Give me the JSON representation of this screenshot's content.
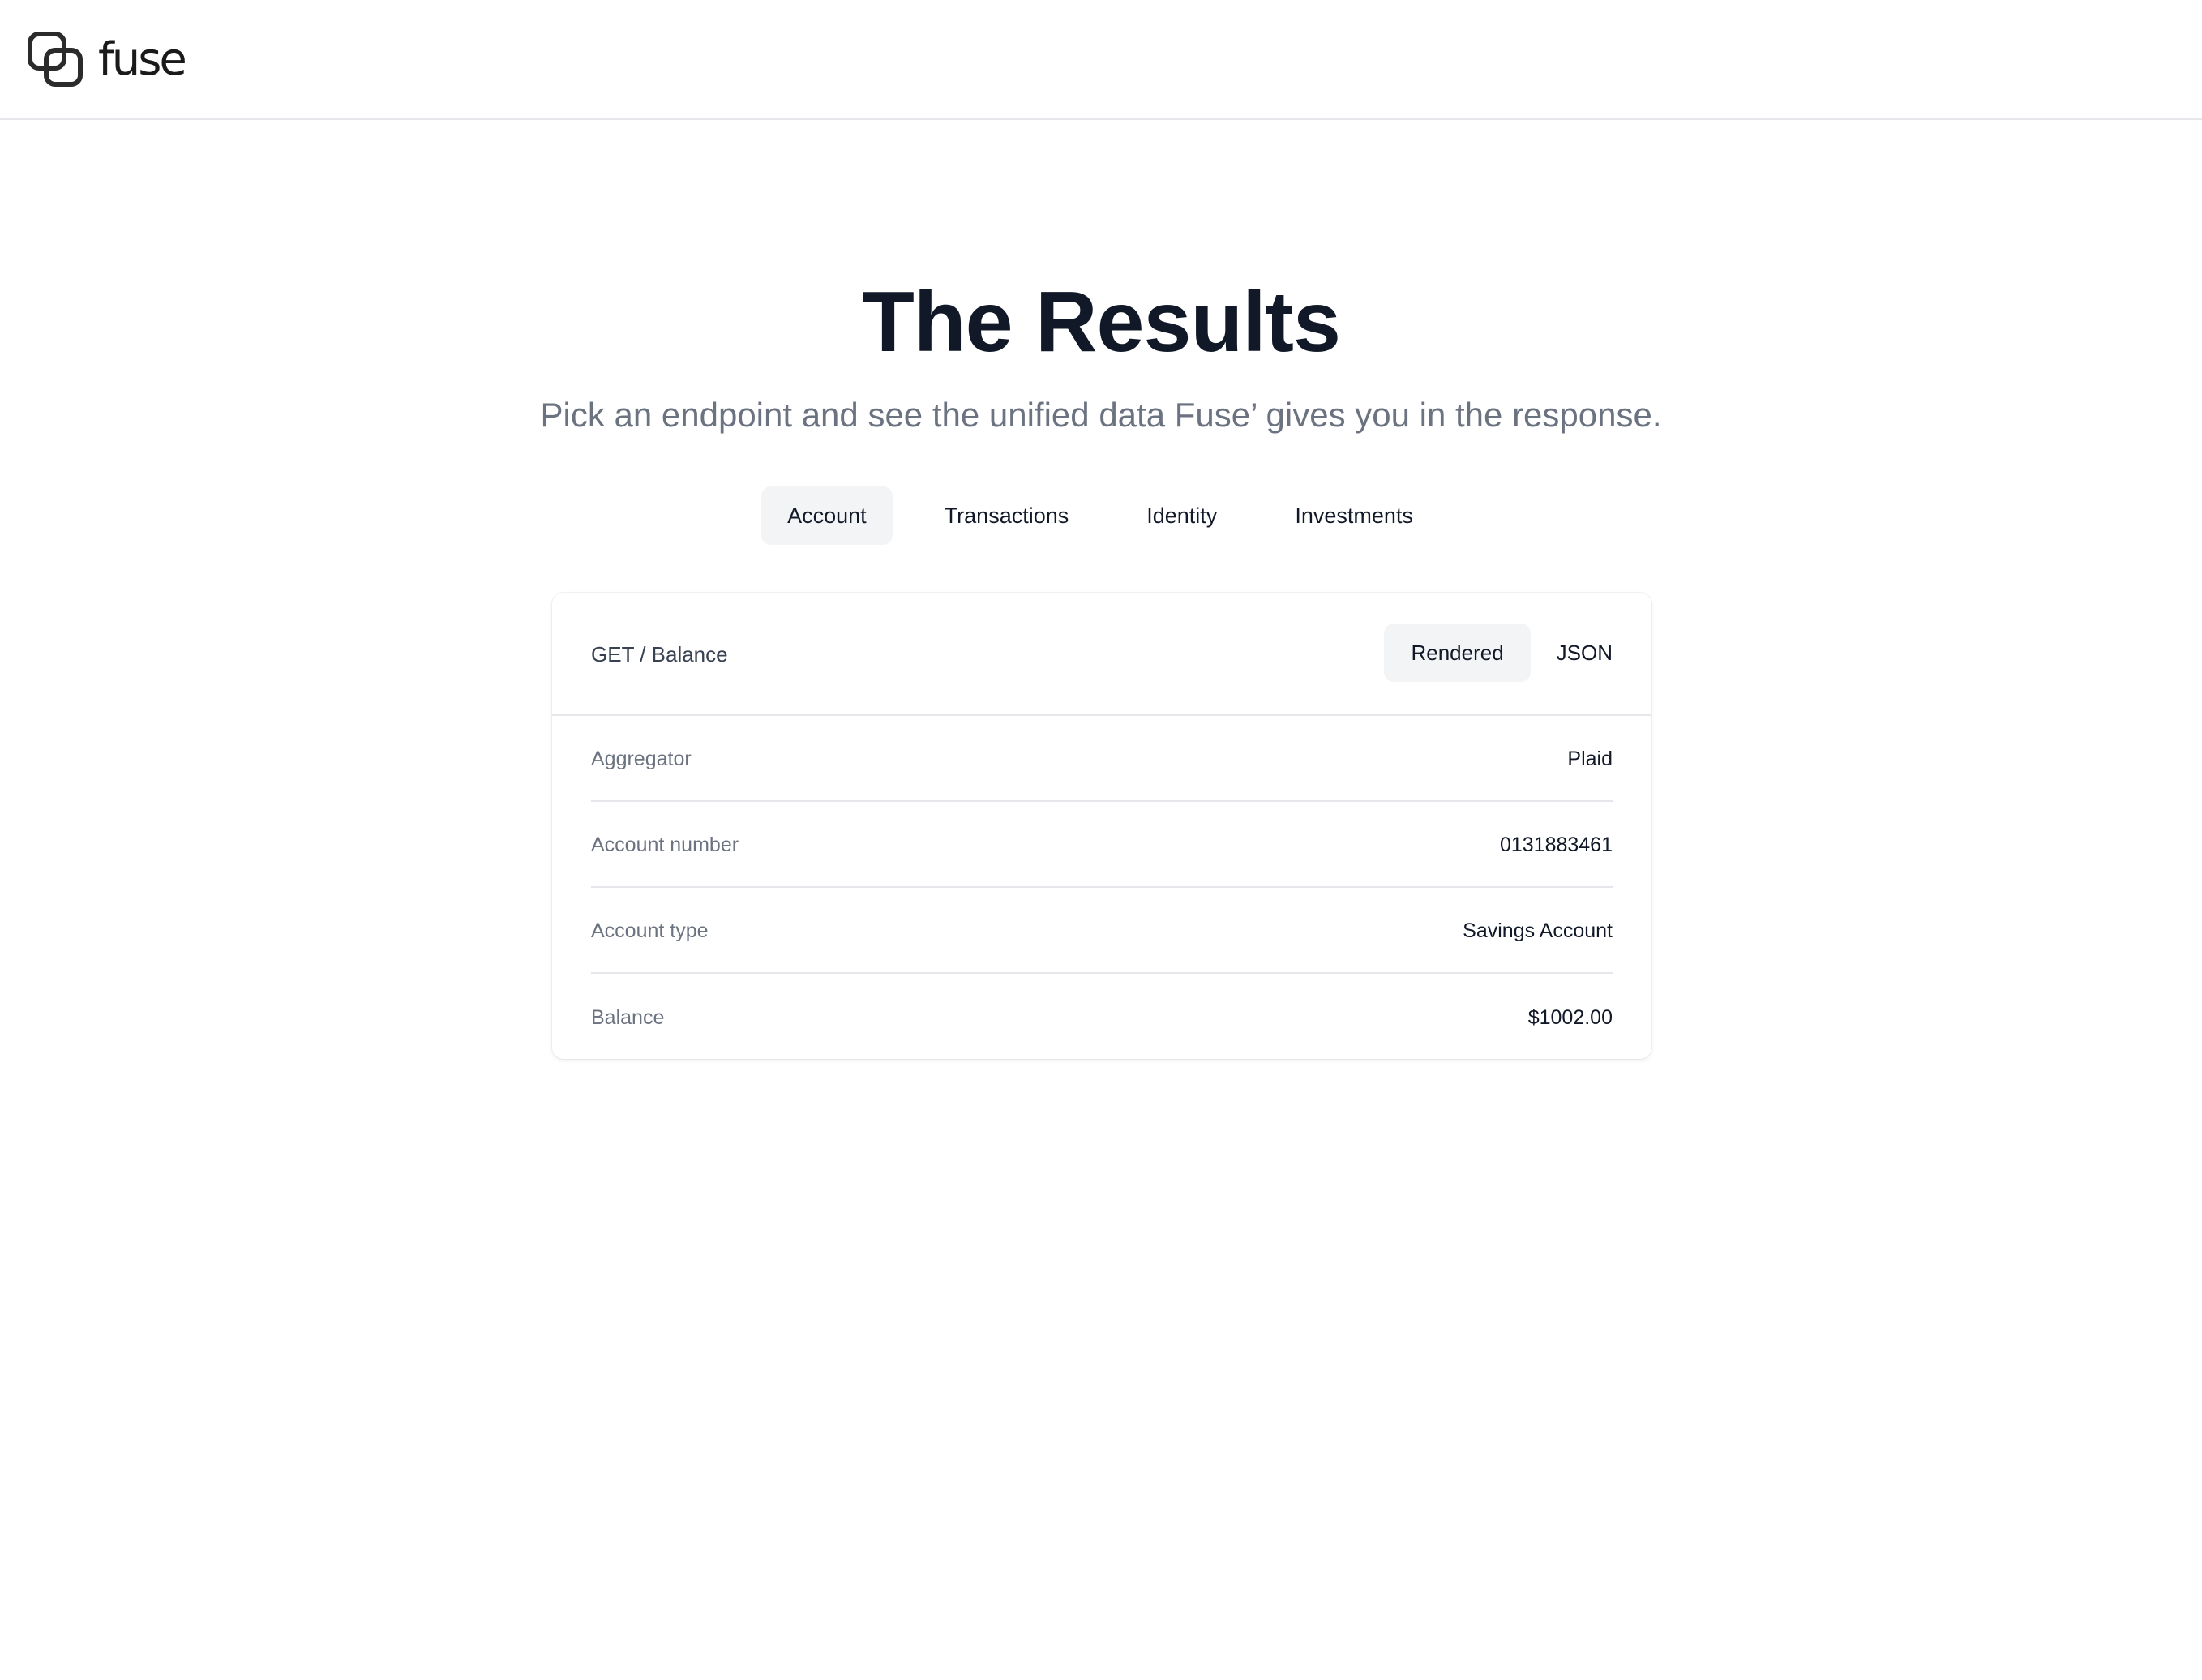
{
  "header": {
    "logo_text": "fuse",
    "logo_icon": "overlapping-squares-logo-icon"
  },
  "hero": {
    "title": "The Results",
    "subtitle": "Pick an endpoint and see the unified data Fuse’ gives you in the response."
  },
  "tabs": [
    {
      "label": "Account",
      "active": true
    },
    {
      "label": "Transactions",
      "active": false
    },
    {
      "label": "Identity",
      "active": false
    },
    {
      "label": "Investments",
      "active": false
    }
  ],
  "card": {
    "endpoint": "GET / Balance",
    "views": [
      {
        "label": "Rendered",
        "active": true
      },
      {
        "label": "JSON",
        "active": false
      }
    ],
    "rows": [
      {
        "label": "Aggregator",
        "value": "Plaid"
      },
      {
        "label": "Account number",
        "value": "0131883461"
      },
      {
        "label": "Account type",
        "value": "Savings Account"
      },
      {
        "label": "Balance",
        "value": "$1002.00"
      }
    ]
  },
  "colors": {
    "heading": "#111827",
    "muted": "#6b7280",
    "active_bg": "#f3f4f6",
    "divider": "#e5e7eb"
  }
}
